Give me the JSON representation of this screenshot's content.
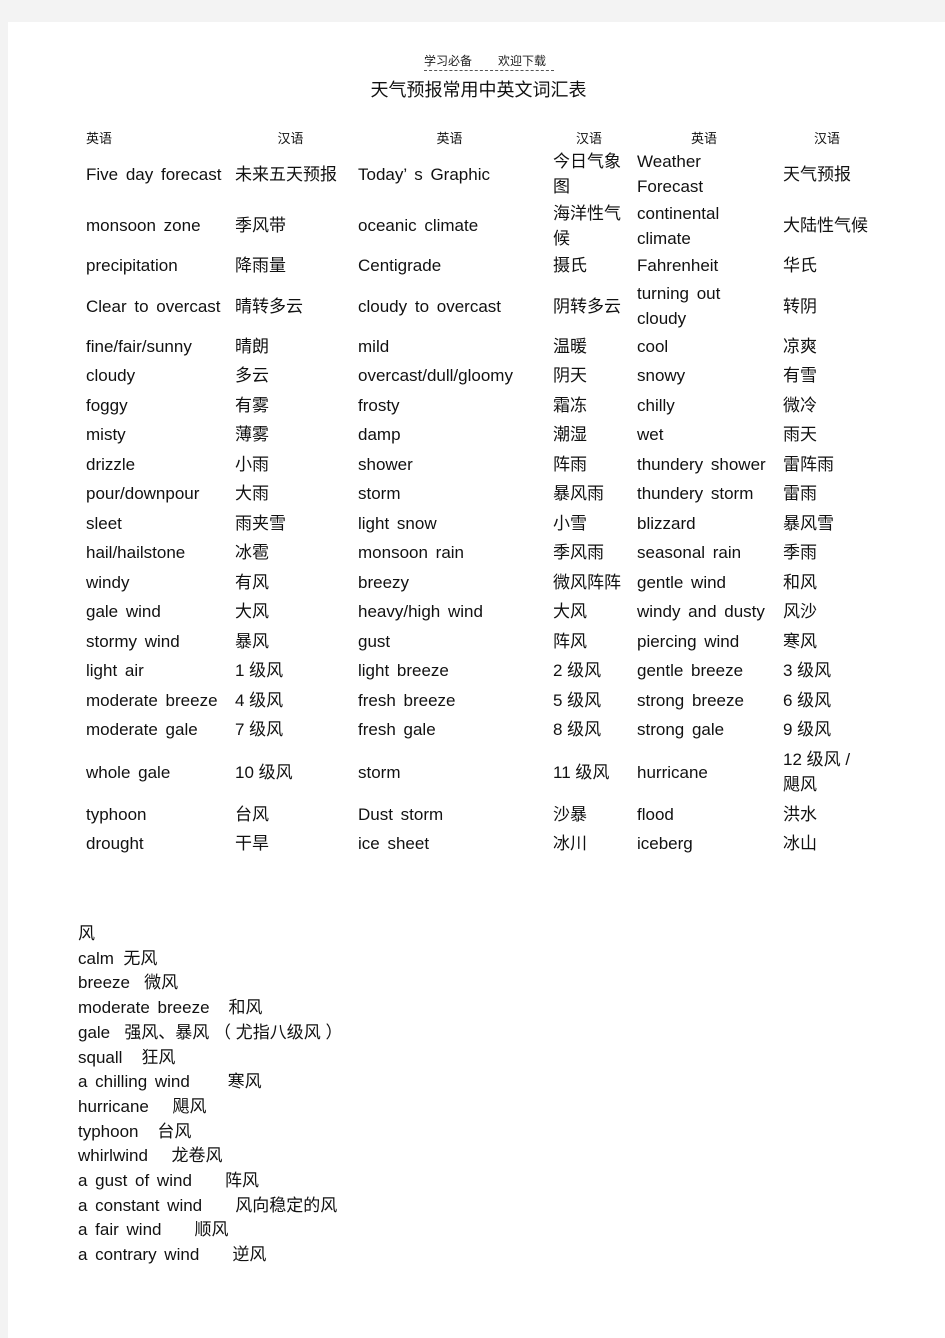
{
  "header": {
    "left": "学习必备",
    "right": "欢迎下载"
  },
  "title": "天气预报常用中英文词汇表",
  "table": {
    "columns": [
      "英语",
      "汉语",
      "英语",
      "汉语",
      "英语",
      "汉语"
    ],
    "rows": [
      [
        "Five day forecast",
        "未来五天预报",
        "Today’ s Graphic",
        "今日气象图",
        "Weather Forecast",
        "天气预报"
      ],
      [
        "monsoon zone",
        "季风带",
        "oceanic climate",
        "海洋性气候",
        "continental climate",
        "大陆性气候"
      ],
      [
        "precipitation",
        "降雨量",
        "Centigrade",
        "摄氏",
        "Fahrenheit",
        "华氏"
      ],
      [
        "Clear to overcast",
        "晴转多云",
        "cloudy to overcast",
        "阴转多云",
        "turning out cloudy",
        "转阴"
      ],
      [
        "fine/fair/sunny",
        "晴朗",
        "mild",
        "温暖",
        "cool",
        "凉爽"
      ],
      [
        "cloudy",
        "多云",
        "overcast/dull/gloomy",
        "阴天",
        "snowy",
        "有雪"
      ],
      [
        "foggy",
        "有雾",
        "frosty",
        "霜冻",
        "chilly",
        "微冷"
      ],
      [
        "misty",
        "薄雾",
        "damp",
        "潮湿",
        "wet",
        "雨天"
      ],
      [
        "drizzle",
        "小雨",
        "shower",
        "阵雨",
        "thundery shower",
        "雷阵雨"
      ],
      [
        "pour/downpour",
        "大雨",
        "storm",
        "暴风雨",
        "thundery storm",
        "雷雨"
      ],
      [
        "sleet",
        "雨夹雪",
        "light snow",
        "小雪",
        "blizzard",
        "暴风雪"
      ],
      [
        "hail/hailstone",
        "冰雹",
        "monsoon rain",
        "季风雨",
        "seasonal rain",
        "季雨"
      ],
      [
        "windy",
        "有风",
        "breezy",
        "微风阵阵",
        "gentle wind",
        "和风"
      ],
      [
        "gale wind",
        "大风",
        "heavy/high wind",
        "大风",
        "windy and dusty",
        "风沙"
      ],
      [
        "stormy wind",
        "暴风",
        "gust",
        "阵风",
        "piercing wind",
        "寒风"
      ],
      [
        "light air",
        "1 级风",
        "light breeze",
        "2 级风",
        "gentle breeze",
        "3 级风"
      ],
      [
        "moderate breeze",
        "4 级风",
        "fresh breeze",
        "5 级风",
        "strong breeze",
        "6 级风"
      ],
      [
        "moderate gale",
        "7 级风",
        "fresh gale",
        "8 级风",
        "strong gale",
        "9 级风"
      ],
      [
        "whole gale",
        "10 级风",
        "storm",
        "11 级风",
        "hurricane",
        "12 级风 / 飓风"
      ],
      [
        "typhoon",
        "台风",
        "Dust storm",
        "沙暴",
        "flood",
        "洪水"
      ],
      [
        "drought",
        "干旱",
        "ice sheet",
        "冰川",
        "iceberg",
        "冰山"
      ]
    ]
  },
  "wind_section": {
    "heading": "风",
    "items": [
      {
        "en": "calm",
        "zh": "无风"
      },
      {
        "en": "breeze",
        "zh": "微风"
      },
      {
        "en": "moderate breeze",
        "zh": "和风"
      },
      {
        "en": "gale",
        "zh": "强风、暴风 （ 尤指八级风 ）"
      },
      {
        "en": "squall",
        "zh": "狂风"
      },
      {
        "en": "a chilling wind",
        "zh": "寒风"
      },
      {
        "en": "hurricane",
        "zh": "飓风"
      },
      {
        "en": "typhoon",
        "zh": "台风"
      },
      {
        "en": "whirlwind",
        "zh": "龙卷风"
      },
      {
        "en": "a gust of wind",
        "zh": "阵风"
      },
      {
        "en": "a constant wind",
        "zh": "风向稳定的风"
      },
      {
        "en": "a fair wind",
        "zh": "顺风"
      },
      {
        "en": "a contrary wind",
        "zh": "逆风"
      }
    ]
  }
}
